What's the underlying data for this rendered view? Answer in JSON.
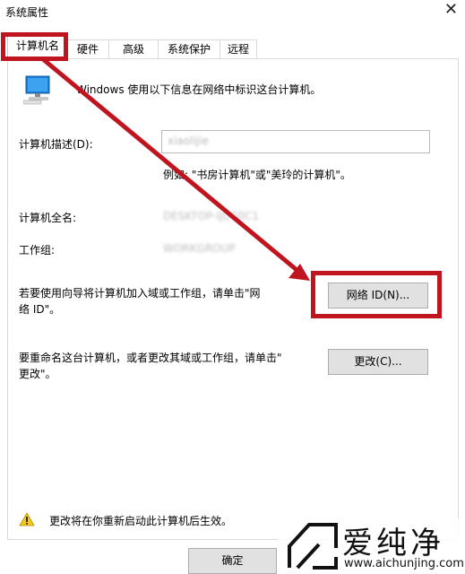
{
  "window": {
    "title": "系统属性"
  },
  "tabs": [
    "计算机名",
    "硬件",
    "高级",
    "系统保护",
    "远程"
  ],
  "intro": "Windows 使用以下信息在网络中标识这台计算机。",
  "description": {
    "label": "计算机描述(D):",
    "value": "xiaolijie",
    "hint": "例如: \"书房计算机\"或\"美玲的计算机\"。"
  },
  "full_name": {
    "label": "计算机全名:",
    "value": "DESKTOP-IJDS0C1"
  },
  "workgroup": {
    "label": "工作组:",
    "value": "WORKGROUP"
  },
  "network_id": {
    "text_line1": "若要使用向导将计算机加入域或工作组，请单击\"网",
    "text_line2": "络 ID\"。",
    "button": "网络 ID(N)..."
  },
  "rename": {
    "text_line1": "要重命名这台计算机，或者更改其域或工作组，请单击\"",
    "text_line2": "更改\"。",
    "button": "更改(C)..."
  },
  "warning": "更改将在你重新启动此计算机后生效。",
  "footer": {
    "ok": "确定"
  },
  "watermark": {
    "brand": "爱纯净",
    "url": "www.aichunjing.com"
  },
  "colors": {
    "highlight": "#c0141f"
  }
}
